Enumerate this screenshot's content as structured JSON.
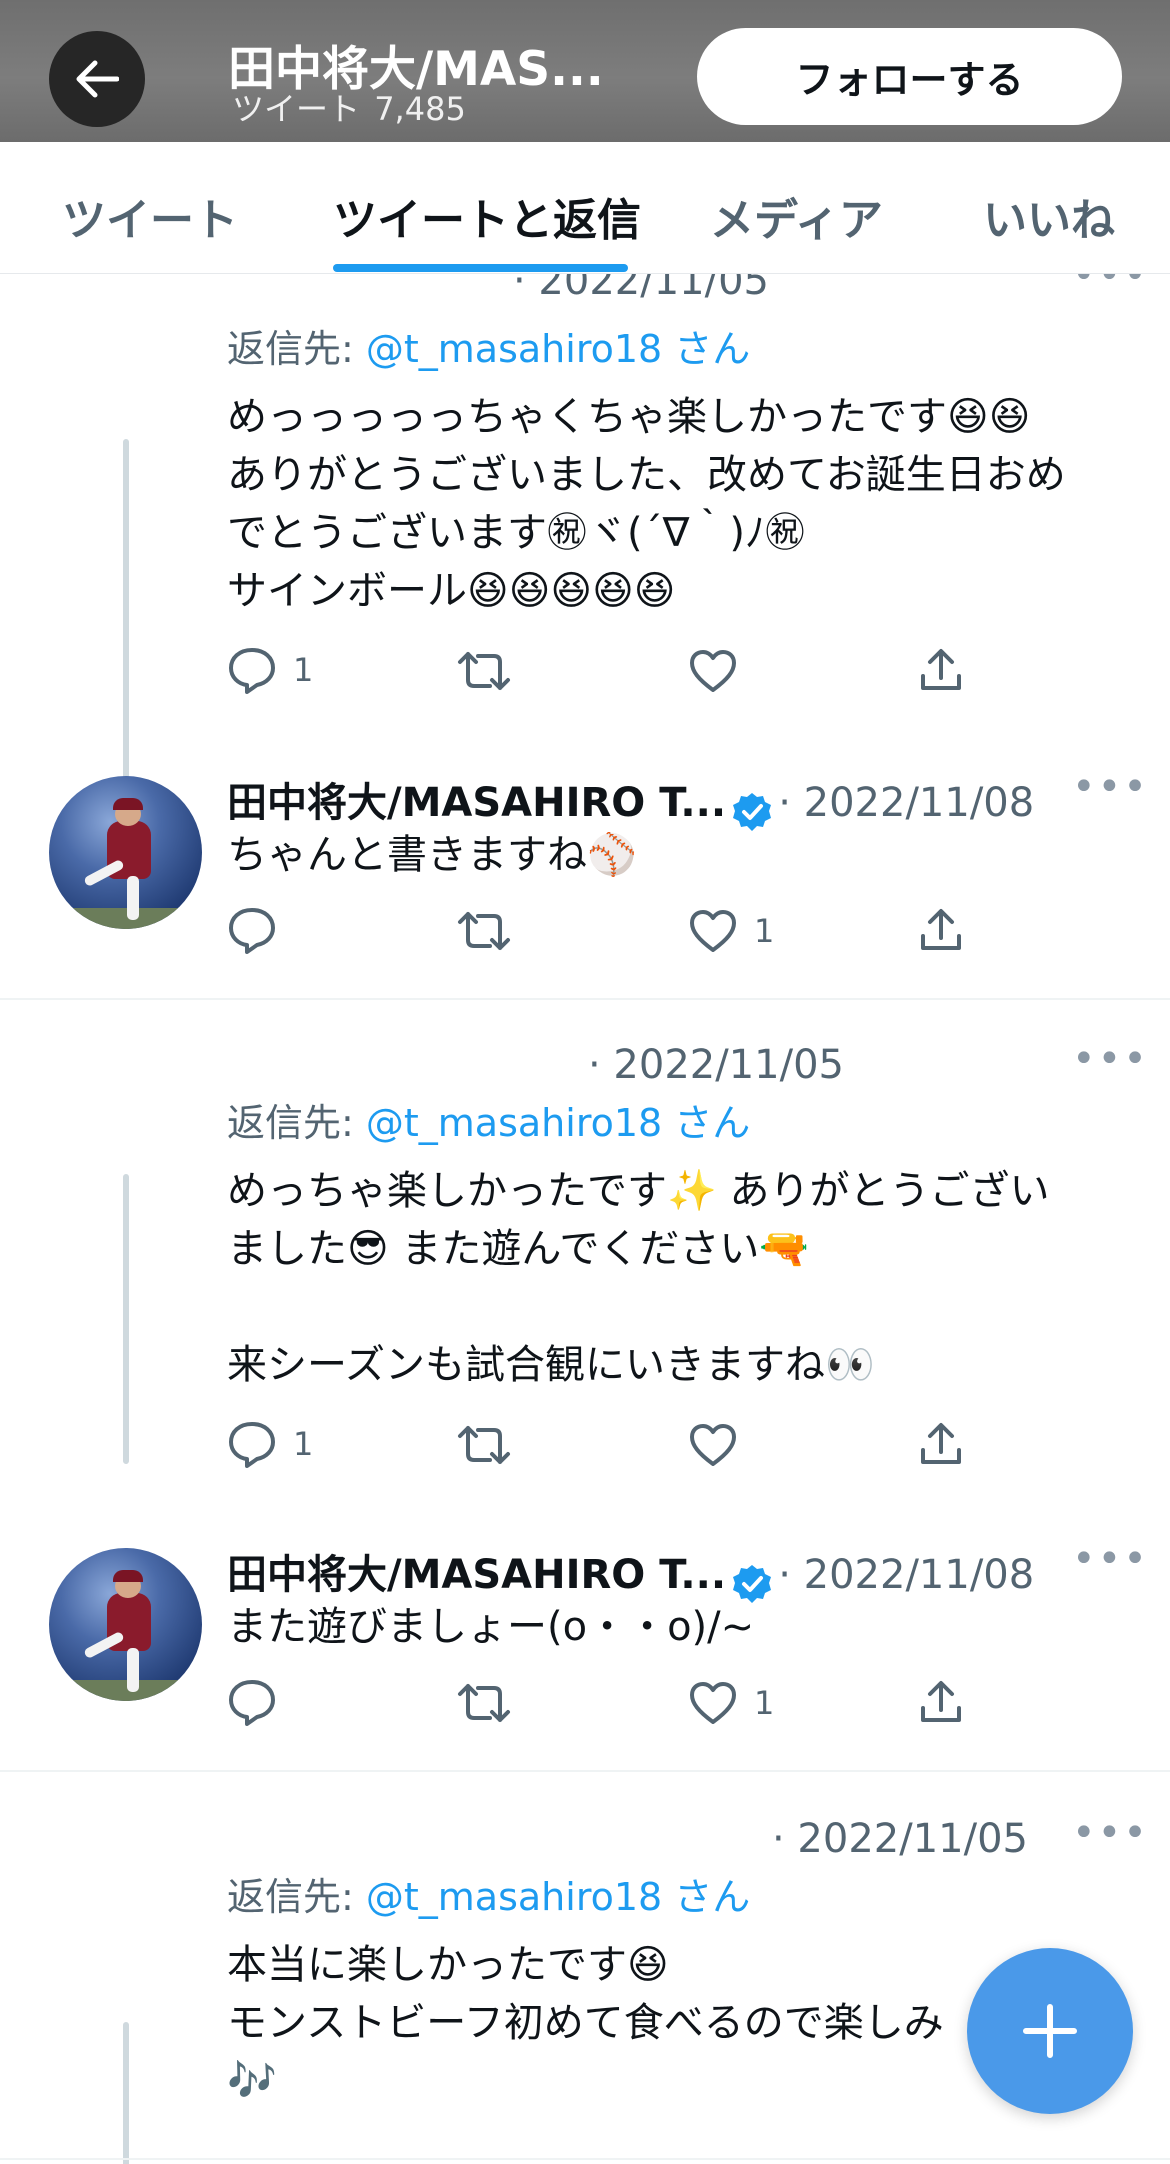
{
  "header": {
    "name": "田中将大/MAS...",
    "tweet_count_label": "ツイート",
    "tweet_count": "7,485",
    "follow_label": "フォローする"
  },
  "tabs": [
    {
      "label": "ツイート",
      "active": false
    },
    {
      "label": "ツイートと返信",
      "active": true
    },
    {
      "label": "メディア",
      "active": false
    },
    {
      "label": "いいね",
      "active": false
    }
  ],
  "threads": [
    {
      "reply": {
        "date": "· 2022/11/05",
        "reply_to_prefix": "返信先: ",
        "reply_to_handle": "@t_masahiro18",
        "reply_to_suffix": " さん",
        "lines": [
          "めっっっっっちゃくちゃ楽しかったです😆😆",
          "ありがとうございました、改めてお誕生日おめ",
          "でとうございます㊗ヾ(´∇｀)ﾉ㊗",
          "サインボール😆😆😆😆😆"
        ],
        "reply_count": "1",
        "like_count": ""
      },
      "tweet": {
        "author": "田中将大/MASAHIRO T...",
        "date": "· 2022/11/08",
        "text": "ちゃんと書きますね⚾",
        "reply_count": "",
        "like_count": "1"
      }
    },
    {
      "reply": {
        "date": "· 2022/11/05",
        "reply_to_prefix": "返信先: ",
        "reply_to_handle": "@t_masahiro18",
        "reply_to_suffix": " さん",
        "lines": [
          "めっちゃ楽しかったです✨ ありがとうござい",
          "ました😎 また遊んでください🔫",
          "",
          "来シーズンも試合観にいきますね👀"
        ],
        "reply_count": "1",
        "like_count": ""
      },
      "tweet": {
        "author": "田中将大/MASAHIRO T...",
        "date": "· 2022/11/08",
        "text": "また遊びましょー(o・・o)/~",
        "reply_count": "",
        "like_count": "1"
      }
    },
    {
      "reply": {
        "date": "· 2022/11/05",
        "reply_to_prefix": "返信先: ",
        "reply_to_handle": "@t_masahiro18",
        "reply_to_suffix": " さん",
        "lines": [
          "本当に楽しかったです😆",
          "モンストビーフ初めて食べるので楽しみ",
          "🎶"
        ]
      }
    }
  ],
  "icons": {
    "back": "arrow-left-icon",
    "reply": "reply-icon",
    "retweet": "retweet-icon",
    "like": "heart-icon",
    "share": "share-icon",
    "more": "more-icon",
    "verified": "verified-badge-icon",
    "compose": "plus-icon"
  },
  "colors": {
    "accent": "#1d9bf0",
    "fab": "#4a99e9",
    "header_bg": "#767676",
    "secondary_text": "#536471"
  },
  "more_glyph": "•••"
}
